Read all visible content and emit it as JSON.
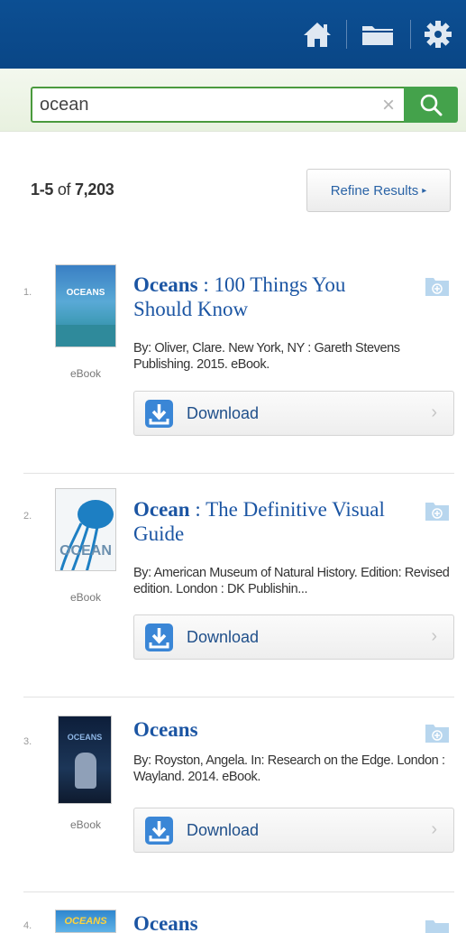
{
  "header": {
    "home_icon": "home-icon",
    "folder_icon": "folder-icon",
    "settings_icon": "gear-icon",
    "color": "#0b4a8c"
  },
  "search": {
    "value": "ocean",
    "placeholder": "",
    "clear_label": "×",
    "button_color": "#44a24b"
  },
  "results_summary": {
    "range": "1-5",
    "of_label": "of",
    "total": "7,203"
  },
  "refine": {
    "label": "Refine Results",
    "caret": "▸"
  },
  "results": [
    {
      "number": "1.",
      "title_main": "Oceans",
      "title_sub": " : 100 Things You Should Know",
      "byline": "By: Oliver, Clare. New York, NY : Gareth Stevens Publishing. 2015. eBook.",
      "format": "eBook",
      "download_label": "Download",
      "cover_text": "OCEANS"
    },
    {
      "number": "2.",
      "title_main": "Ocean",
      "title_sub": " : The Definitive Visual Guide",
      "byline": "By: American Museum of Natural History. Edition: Revised edition. London : DK Publishin...",
      "format": "eBook",
      "download_label": "Download",
      "cover_text": "OCEAN"
    },
    {
      "number": "3.",
      "title_main": "Oceans",
      "title_sub": "",
      "byline": "By: Royston, Angela. In: Research on the Edge. London : Wayland. 2014. eBook.",
      "format": "eBook",
      "download_label": "Download",
      "cover_text": "OCEANS"
    },
    {
      "number": "4.",
      "title_main": "Oceans",
      "title_sub": "",
      "byline": "",
      "format": "",
      "download_label": "",
      "cover_text": "OCEANS"
    }
  ]
}
